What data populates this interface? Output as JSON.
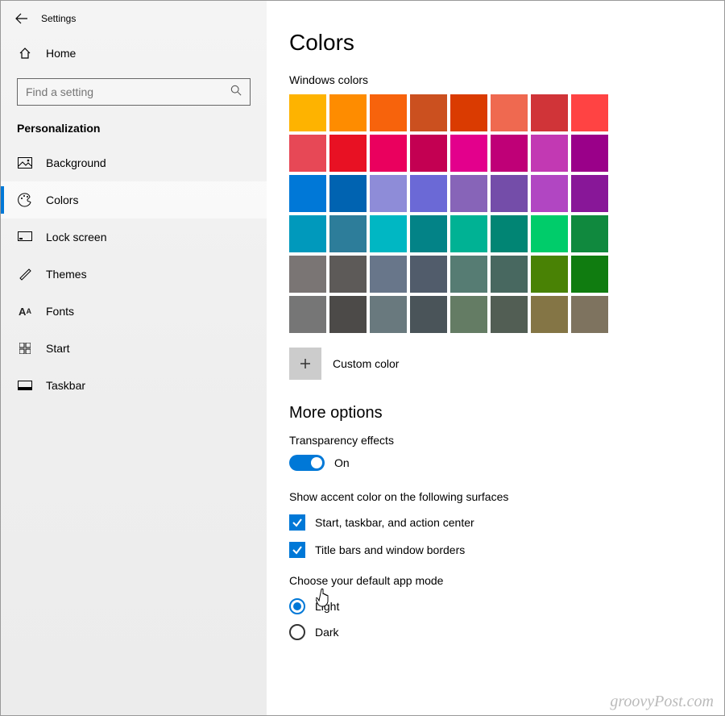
{
  "titlebar": {
    "title": "Settings"
  },
  "sidebar": {
    "home_label": "Home",
    "search_placeholder": "Find a setting",
    "section_label": "Personalization",
    "items": [
      {
        "label": "Background",
        "icon": "picture-icon",
        "selected": false
      },
      {
        "label": "Colors",
        "icon": "palette-icon",
        "selected": true
      },
      {
        "label": "Lock screen",
        "icon": "monitor-icon",
        "selected": false
      },
      {
        "label": "Themes",
        "icon": "brush-icon",
        "selected": false
      },
      {
        "label": "Fonts",
        "icon": "font-icon",
        "selected": false
      },
      {
        "label": "Start",
        "icon": "start-icon",
        "selected": false
      },
      {
        "label": "Taskbar",
        "icon": "taskbar-icon",
        "selected": false
      }
    ]
  },
  "main": {
    "page_title": "Colors",
    "windows_colors_label": "Windows colors",
    "swatches": [
      "#feb300",
      "#fe8c00",
      "#f7630c",
      "#cb501f",
      "#da3b01",
      "#ef6950",
      "#d03438",
      "#ff4343",
      "#e74856",
      "#e81123",
      "#ea005e",
      "#c30052",
      "#e3008c",
      "#bf0077",
      "#c239b3",
      "#9a0089",
      "#0078d7",
      "#0063b1",
      "#8e8cd8",
      "#6b69d6",
      "#8764b8",
      "#744da9",
      "#b146c2",
      "#881798",
      "#0099bc",
      "#2d7d9a",
      "#00b7c3",
      "#038387",
      "#00b294",
      "#018574",
      "#00cc6a",
      "#10893e",
      "#7a7574",
      "#5d5a58",
      "#68768a",
      "#515c6b",
      "#567c73",
      "#486860",
      "#498205",
      "#107c10",
      "#767676",
      "#4c4a48",
      "#69797e",
      "#4a5459",
      "#647c64",
      "#525e54",
      "#847545",
      "#7e735f"
    ],
    "custom_color_label": "Custom color",
    "more_options_heading": "More options",
    "transparency_label": "Transparency effects",
    "transparency_state": "On",
    "accent_surfaces_label": "Show accent color on the following surfaces",
    "checkbox1_label": "Start, taskbar, and action center",
    "checkbox2_label": "Title bars and window borders",
    "app_mode_label": "Choose your default app mode",
    "radio_light": "Light",
    "radio_dark": "Dark"
  },
  "watermark": "groovyPost.com",
  "accent_color": "#0078d7"
}
